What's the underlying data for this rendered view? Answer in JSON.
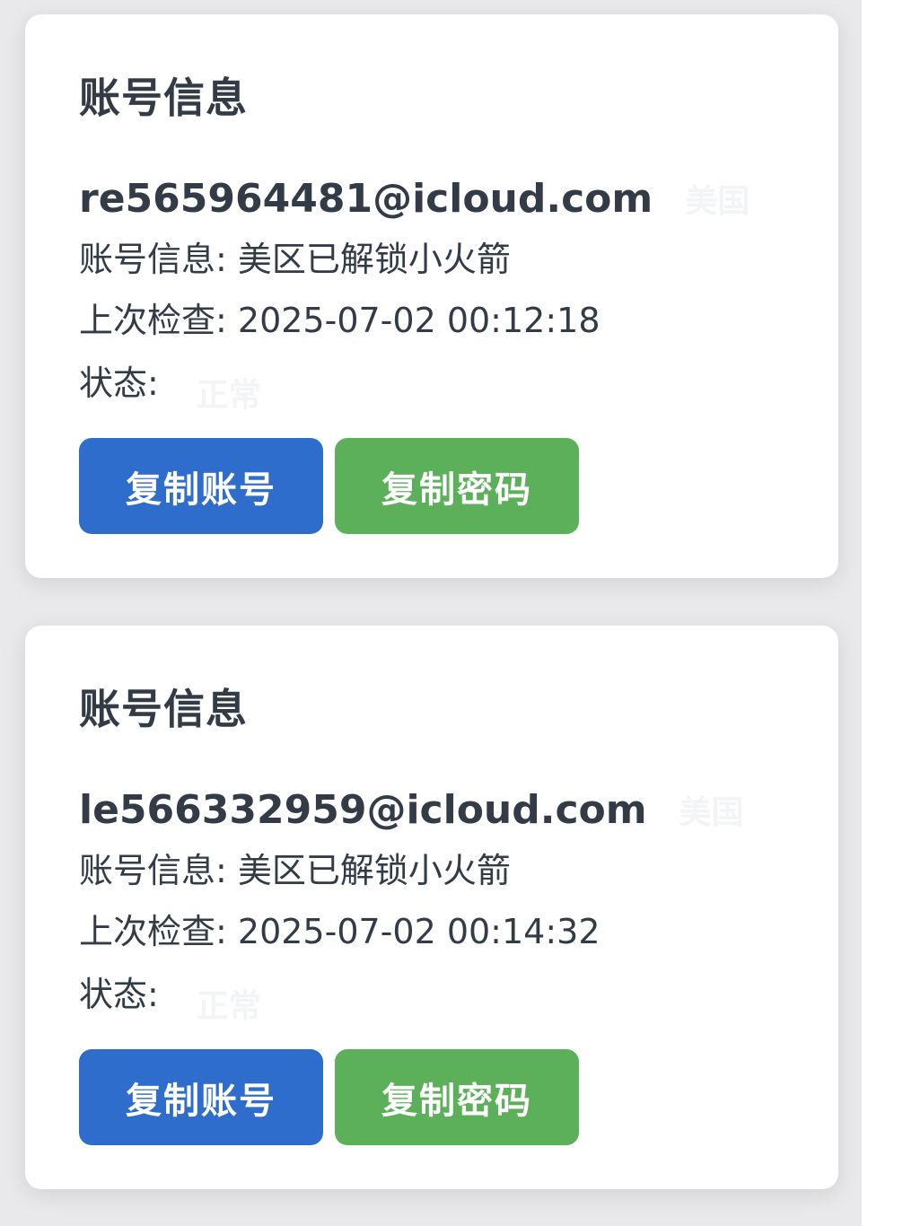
{
  "accounts": [
    {
      "title": "账号信息",
      "email": "re565964481@icloud.com",
      "region": "美国",
      "info_label": "账号信息:",
      "info_value": "美区已解锁小火箭",
      "check_label": "上次检查:",
      "check_value": "2025-07-02 00:12:18",
      "status_label": "状态:",
      "status_value": "正常",
      "copy_account_label": "复制账号",
      "copy_password_label": "复制密码"
    },
    {
      "title": "账号信息",
      "email": "le566332959@icloud.com",
      "region": "美国",
      "info_label": "账号信息:",
      "info_value": "美区已解锁小火箭",
      "check_label": "上次检查:",
      "check_value": "2025-07-02 00:14:32",
      "status_label": "状态:",
      "status_value": "正常",
      "copy_account_label": "复制账号",
      "copy_password_label": "复制密码"
    }
  ],
  "colors": {
    "page_background": "#e9e9eb",
    "card_background": "#ffffff",
    "text": "#333b47",
    "faded_text": "#f3f4f6",
    "copy_account_button": "#2f6dcc",
    "copy_password_button": "#5cb05a"
  }
}
